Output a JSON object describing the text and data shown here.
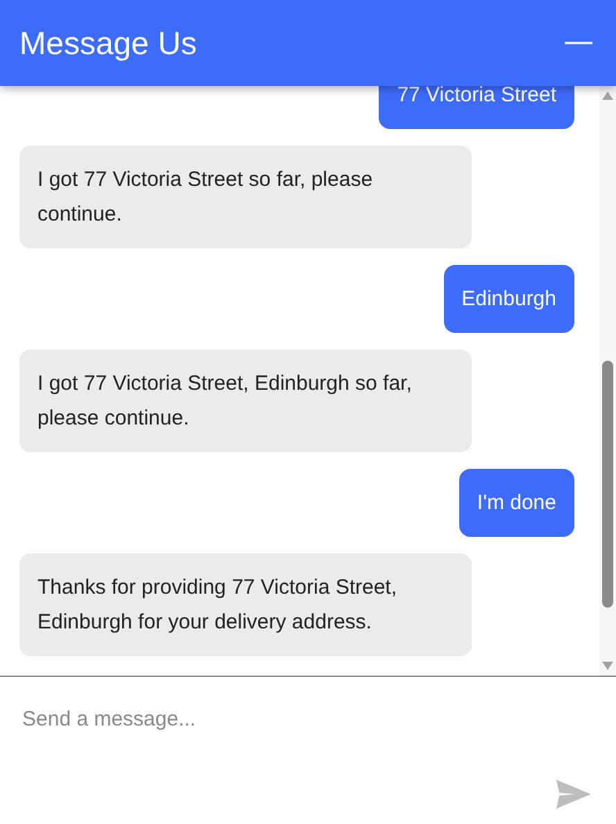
{
  "header": {
    "title": "Message Us",
    "minimize": "—"
  },
  "messages": [
    {
      "kind": "sent",
      "text": "77 Victoria Street"
    },
    {
      "kind": "received",
      "text": "I got 77 Victoria Street so far, please continue."
    },
    {
      "kind": "sent",
      "text": "Edinburgh"
    },
    {
      "kind": "received",
      "text": "I got 77 Victoria Street, Edinburgh so far, please continue."
    },
    {
      "kind": "sent",
      "text": "I'm done"
    },
    {
      "kind": "received",
      "text": "Thanks for providing 77 Victoria Street, Edinburgh for your delivery address."
    }
  ],
  "composer": {
    "placeholder": "Send a message..."
  }
}
